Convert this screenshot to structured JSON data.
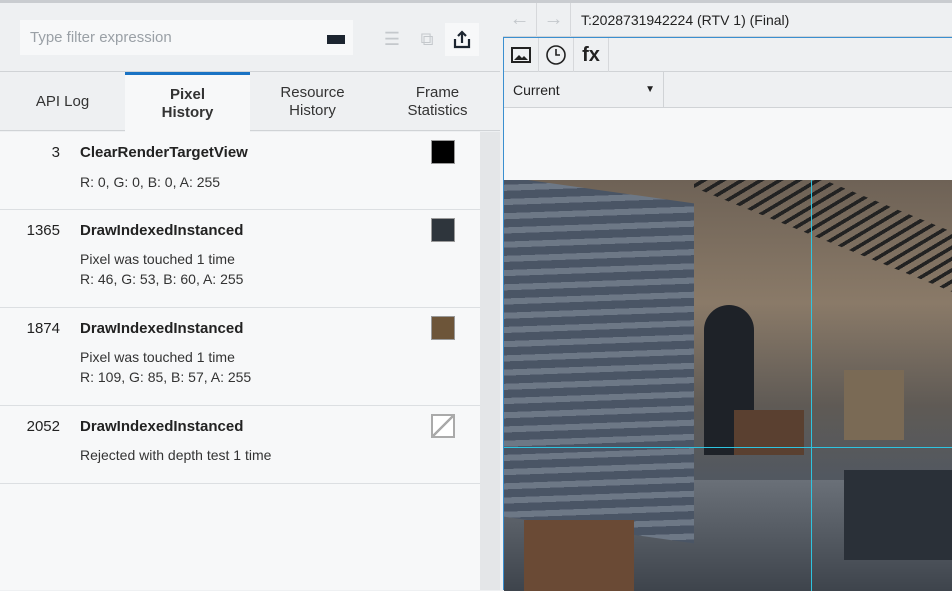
{
  "filter": {
    "placeholder": "Type filter expression"
  },
  "tabs": [
    {
      "label": "API Log"
    },
    {
      "label": "Pixel\nHistory"
    },
    {
      "label": "Resource\nHistory"
    },
    {
      "label": "Frame\nStatistics"
    }
  ],
  "history": [
    {
      "id": "3",
      "name": "ClearRenderTargetView",
      "lines": [
        "R: 0, G: 0, B: 0, A: 255"
      ],
      "color": "#000000"
    },
    {
      "id": "1365",
      "name": "DrawIndexedInstanced",
      "lines": [
        "Pixel was touched 1 time",
        "R: 46, G: 53, B: 60, A: 255"
      ],
      "color": "#2e353c"
    },
    {
      "id": "1874",
      "name": "DrawIndexedInstanced",
      "lines": [
        "Pixel was touched 1 time",
        "R: 109, G: 85, B: 57, A: 255"
      ],
      "color": "#6d5539"
    },
    {
      "id": "2052",
      "name": "DrawIndexedInstanced",
      "lines": [
        "Rejected with depth test 1 time"
      ],
      "color": "none"
    }
  ],
  "viewer": {
    "title": "T:2028731942224 (RTV 1) (Final)",
    "select": "Current",
    "fx_label": "fx"
  }
}
